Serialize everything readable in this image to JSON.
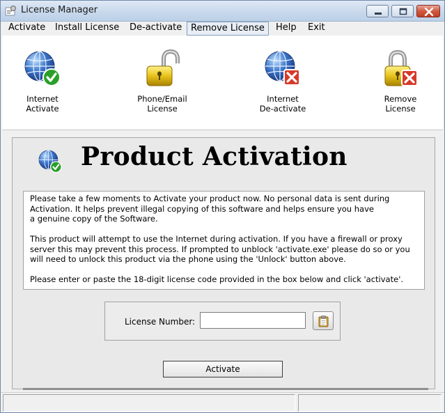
{
  "window": {
    "title": "License Manager"
  },
  "menu": {
    "items": [
      {
        "label": "Activate"
      },
      {
        "label": "Install License"
      },
      {
        "label": "De-activate"
      },
      {
        "label": "Remove License",
        "active": true
      },
      {
        "label": "Help"
      },
      {
        "label": "Exit"
      }
    ]
  },
  "toolbar": {
    "items": [
      {
        "label": "Internet\nActivate",
        "icon": "globe-check-icon"
      },
      {
        "label": "Phone/Email\nLicense",
        "icon": "padlock-open-icon"
      },
      {
        "label": "Internet\nDe-activate",
        "icon": "globe-x-icon"
      },
      {
        "label": "Remove\nLicense",
        "icon": "padlock-x-icon"
      }
    ]
  },
  "panel": {
    "heading": "Product Activation",
    "paragraphs": [
      "Please take a few moments to Activate your product now.  No personal data is sent during\nActivation.  It helps prevent illegal copying of this software and helps ensure you have\na genuine copy of the Software.",
      "This product will attempt to use the Internet during activation.  If you have a firewall or proxy\nserver this may prevent this process.  If prompted to unblock 'activate.exe' please do so or you\nwill need to unlock this product via the phone using the 'Unlock' button above.",
      "Please enter or paste the 18-digit license code provided in the box below and click 'activate'."
    ],
    "license_label": "License Number:",
    "license_value": "",
    "activate_label": "Activate"
  },
  "colors": {
    "globe_blue": "#3a73c8",
    "check_green": "#2aa02a",
    "error_red": "#d63a2a",
    "lock_gold": "#e8c21a"
  }
}
